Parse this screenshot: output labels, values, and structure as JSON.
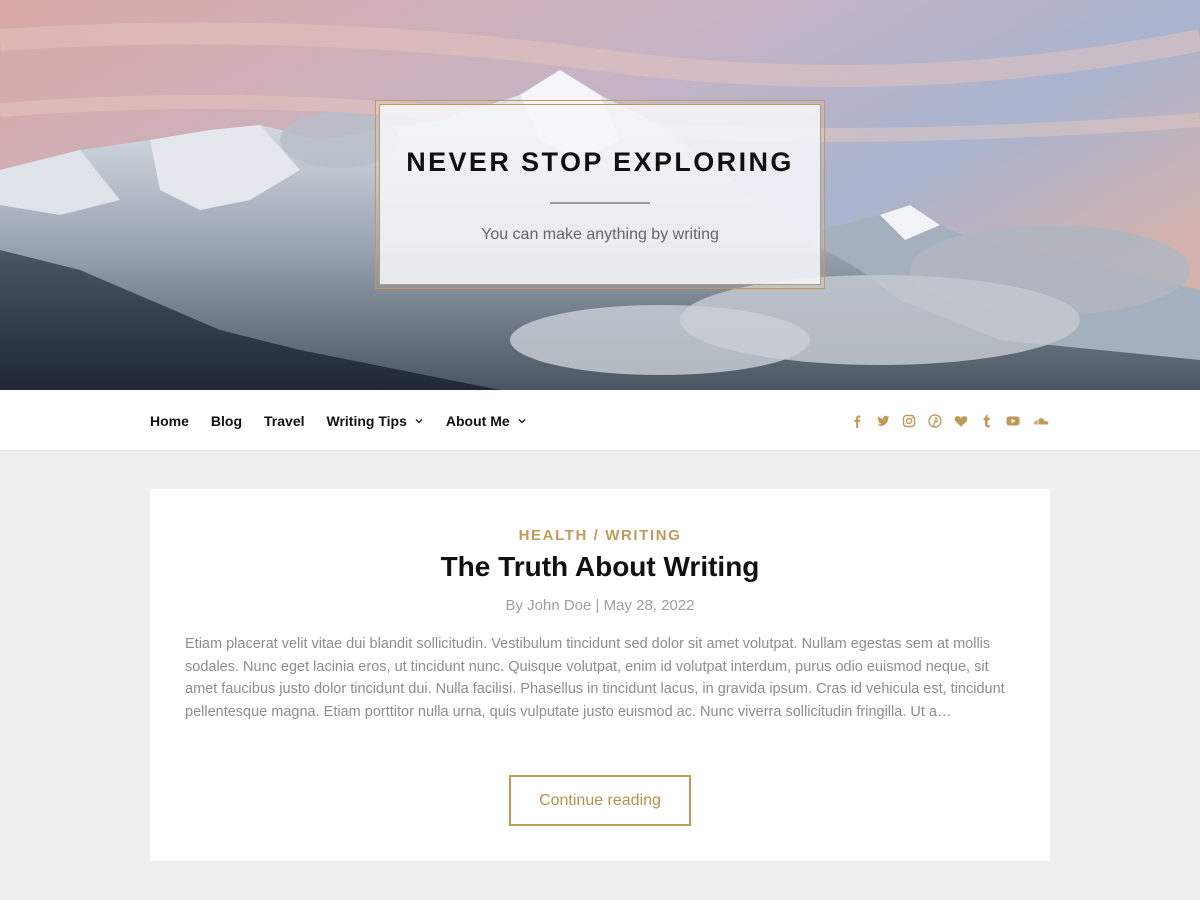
{
  "header": {
    "site_title": "NEVER STOP EXPLORING",
    "tagline": "You can make anything by writing"
  },
  "nav": {
    "items": [
      {
        "label": "Home",
        "has_dropdown": false
      },
      {
        "label": "Blog",
        "has_dropdown": false
      },
      {
        "label": "Travel",
        "has_dropdown": false
      },
      {
        "label": "Writing Tips",
        "has_dropdown": true
      },
      {
        "label": "About Me",
        "has_dropdown": true
      }
    ],
    "social_icons": [
      "facebook-icon",
      "twitter-icon",
      "instagram-icon",
      "pinterest-icon",
      "bloglovin-heart-icon",
      "tumblr-icon",
      "youtube-icon",
      "soundcloud-icon"
    ]
  },
  "post": {
    "categories": "HEALTH / WRITING",
    "title": "The Truth About Writing",
    "meta": "By John Doe | May 28, 2022",
    "excerpt": "Etiam placerat velit vitae dui blandit sollicitudin. Vestibulum tincidunt sed dolor sit amet volutpat. Nullam egestas sem at mollis sodales. Nunc eget lacinia eros, ut tincidunt nunc. Quisque volutpat, enim id volutpat interdum, purus odio euismod neque, sit amet faucibus justo dolor tincidunt dui. Nulla facilisi. Phasellus in tincidunt lacus, in gravida ipsum. Cras id vehicula est, tincidunt pellentesque magna. Etiam porttitor nulla urna, quis vulputate justo euismod ac. Nunc viverra sollicitudin fringilla. Ut a…",
    "button_label": "Continue reading"
  },
  "colors": {
    "accent": "#c09a5b",
    "page_background": "#eeeeee",
    "text": "#111111",
    "muted": "#8d8d8d"
  }
}
